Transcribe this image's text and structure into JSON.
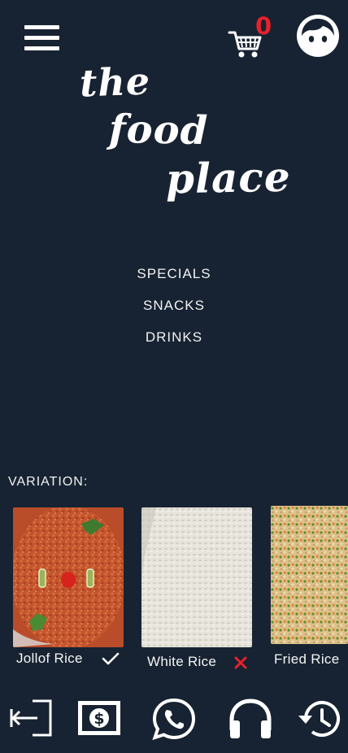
{
  "header": {
    "menu_icon": "hamburger-menu-icon",
    "cart_icon": "shopping-cart-icon",
    "cart_count": "0",
    "avatar_icon": "user-face-icon"
  },
  "logo": {
    "line1": "the",
    "line2": "food",
    "line3": "place"
  },
  "categories": [
    {
      "label": "SPECIALS"
    },
    {
      "label": "SNACKS"
    },
    {
      "label": "DRINKS"
    }
  ],
  "variation": {
    "label": "VARIATION:",
    "items": [
      {
        "name": "Jollof Rice",
        "status": "selected",
        "status_icon": "check-icon"
      },
      {
        "name": "White Rice",
        "status": "unavailable",
        "status_icon": "close-icon"
      },
      {
        "name": "Fried Rice",
        "status": "none",
        "status_icon": ""
      }
    ]
  },
  "bottom_nav": [
    {
      "icon": "logout-icon"
    },
    {
      "icon": "money-icon"
    },
    {
      "icon": "whatsapp-icon"
    },
    {
      "icon": "headphones-support-icon"
    },
    {
      "icon": "history-icon"
    }
  ],
  "colors": {
    "background": "#172332",
    "accent_red": "#e8212b",
    "text": "#ffffff"
  }
}
